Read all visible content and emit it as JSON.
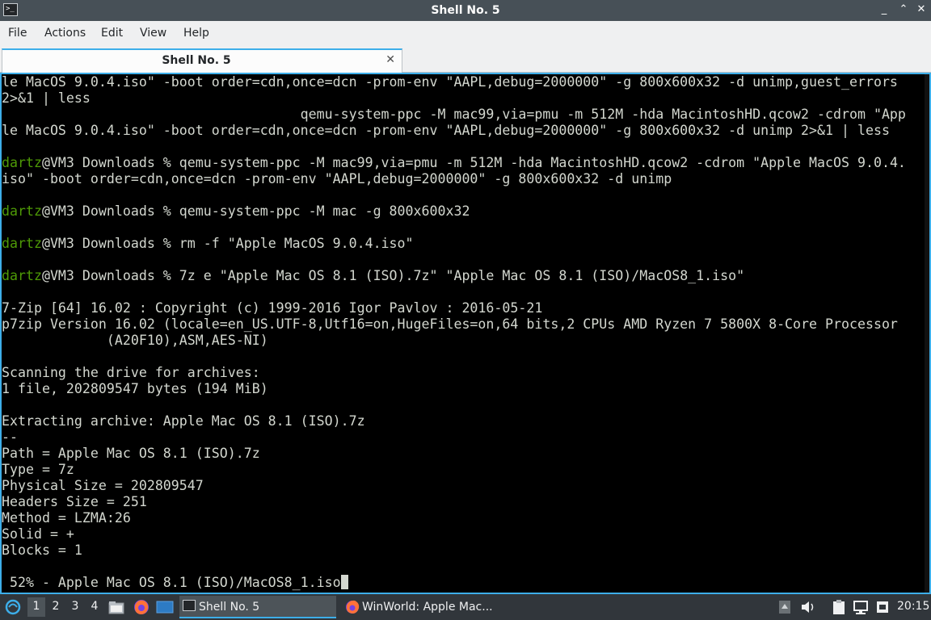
{
  "window": {
    "title": "Shell No. 5",
    "buttons": {
      "minimize": "_",
      "restore": "⌃",
      "close": "✕"
    }
  },
  "menu": {
    "items": [
      "File",
      "Actions",
      "Edit",
      "View",
      "Help"
    ]
  },
  "tabs": [
    {
      "label": "Shell No. 5",
      "close": "✕"
    }
  ],
  "terminal": {
    "prompt_user": "dartz",
    "prompt_rest": "@VM3 Downloads % ",
    "lines": [
      {
        "text": "le MacOS 9.0.4.iso\" -boot order=cdn,once=dcn -prom-env \"AAPL,debug=2000000\" -g 800x600x32 -d unimp,guest_errors"
      },
      {
        "text": "2>&1 | less"
      },
      {
        "text": "                                     qemu-system-ppc -M mac99,via=pmu -m 512M -hda MacintoshHD.qcow2 -cdrom \"App"
      },
      {
        "text": "le MacOS 9.0.4.iso\" -boot order=cdn,once=dcn -prom-env \"AAPL,debug=2000000\" -g 800x600x32 -d unimp 2>&1 | less"
      },
      {
        "text": ""
      },
      {
        "prompt": true,
        "text": "qemu-system-ppc -M mac99,via=pmu -m 512M -hda MacintoshHD.qcow2 -cdrom \"Apple MacOS 9.0.4."
      },
      {
        "text": "iso\" -boot order=cdn,once=dcn -prom-env \"AAPL,debug=2000000\" -g 800x600x32 -d unimp"
      },
      {
        "text": ""
      },
      {
        "prompt": true,
        "text": "qemu-system-ppc -M mac -g 800x600x32"
      },
      {
        "text": ""
      },
      {
        "prompt": true,
        "text": "rm -f \"Apple MacOS 9.0.4.iso\""
      },
      {
        "text": ""
      },
      {
        "prompt": true,
        "text": "7z e \"Apple Mac OS 8.1 (ISO).7z\" \"Apple Mac OS 8.1 (ISO)/MacOS8_1.iso\""
      },
      {
        "text": ""
      },
      {
        "text": "7-Zip [64] 16.02 : Copyright (c) 1999-2016 Igor Pavlov : 2016-05-21"
      },
      {
        "text": "p7zip Version 16.02 (locale=en_US.UTF-8,Utf16=on,HugeFiles=on,64 bits,2 CPUs AMD Ryzen 7 5800X 8-Core Processor"
      },
      {
        "text": "             (A20F10),ASM,AES-NI)"
      },
      {
        "text": ""
      },
      {
        "text": "Scanning the drive for archives:"
      },
      {
        "text": "1 file, 202809547 bytes (194 MiB)"
      },
      {
        "text": ""
      },
      {
        "text": "Extracting archive: Apple Mac OS 8.1 (ISO).7z"
      },
      {
        "text": "--"
      },
      {
        "text": "Path = Apple Mac OS 8.1 (ISO).7z"
      },
      {
        "text": "Type = 7z"
      },
      {
        "text": "Physical Size = 202809547"
      },
      {
        "text": "Headers Size = 251"
      },
      {
        "text": "Method = LZMA:26"
      },
      {
        "text": "Solid = +"
      },
      {
        "text": "Blocks = 1"
      },
      {
        "text": ""
      },
      {
        "text": " 52% - Apple Mac OS 8.1 (ISO)/MacOS8_1.iso",
        "cursor": true
      }
    ]
  },
  "taskbar": {
    "desktops": [
      "1",
      "2",
      "3",
      "4"
    ],
    "active_desktop": "1",
    "tasks": [
      {
        "label": "Shell No. 5",
        "icon": "terminal-icon",
        "active": true
      },
      {
        "label": "WinWorld: Apple Mac...",
        "icon": "firefox-icon",
        "active": false
      }
    ],
    "clock": "20:15"
  }
}
